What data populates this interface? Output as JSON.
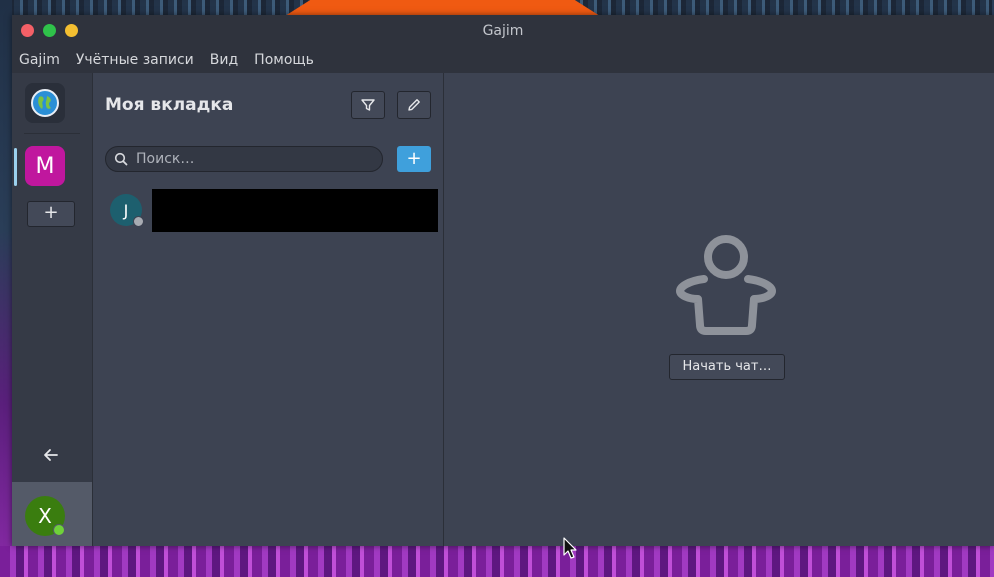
{
  "window": {
    "title": "Gajim"
  },
  "menu": {
    "items": [
      "Gajim",
      "Учётные записи",
      "Вид",
      "Помощь"
    ]
  },
  "workspaces": {
    "active_initial": "M",
    "active_color": "#c0179e",
    "add_label": "+"
  },
  "account": {
    "initial": "X",
    "color": "#3a7d0f",
    "status_color": "#6fd13a"
  },
  "chatlist": {
    "title": "Моя вкладка",
    "search_placeholder": "Поиск…",
    "add_label": "+",
    "chats": [
      {
        "initial": "J",
        "avatar_color": "#1d5f6e",
        "status_color": "#a8abb2"
      }
    ]
  },
  "main": {
    "start_chat_label": "Начать чат…"
  },
  "colors": {
    "accent": "#3fa0dc",
    "window_bg": "#3d4352",
    "titlebar_bg": "#2f333d"
  },
  "icons": [
    "globe-logo-icon",
    "arrow-left-icon",
    "filter-icon",
    "pencil-icon",
    "search-icon",
    "person-placeholder-icon",
    "mouse-cursor-icon"
  ]
}
